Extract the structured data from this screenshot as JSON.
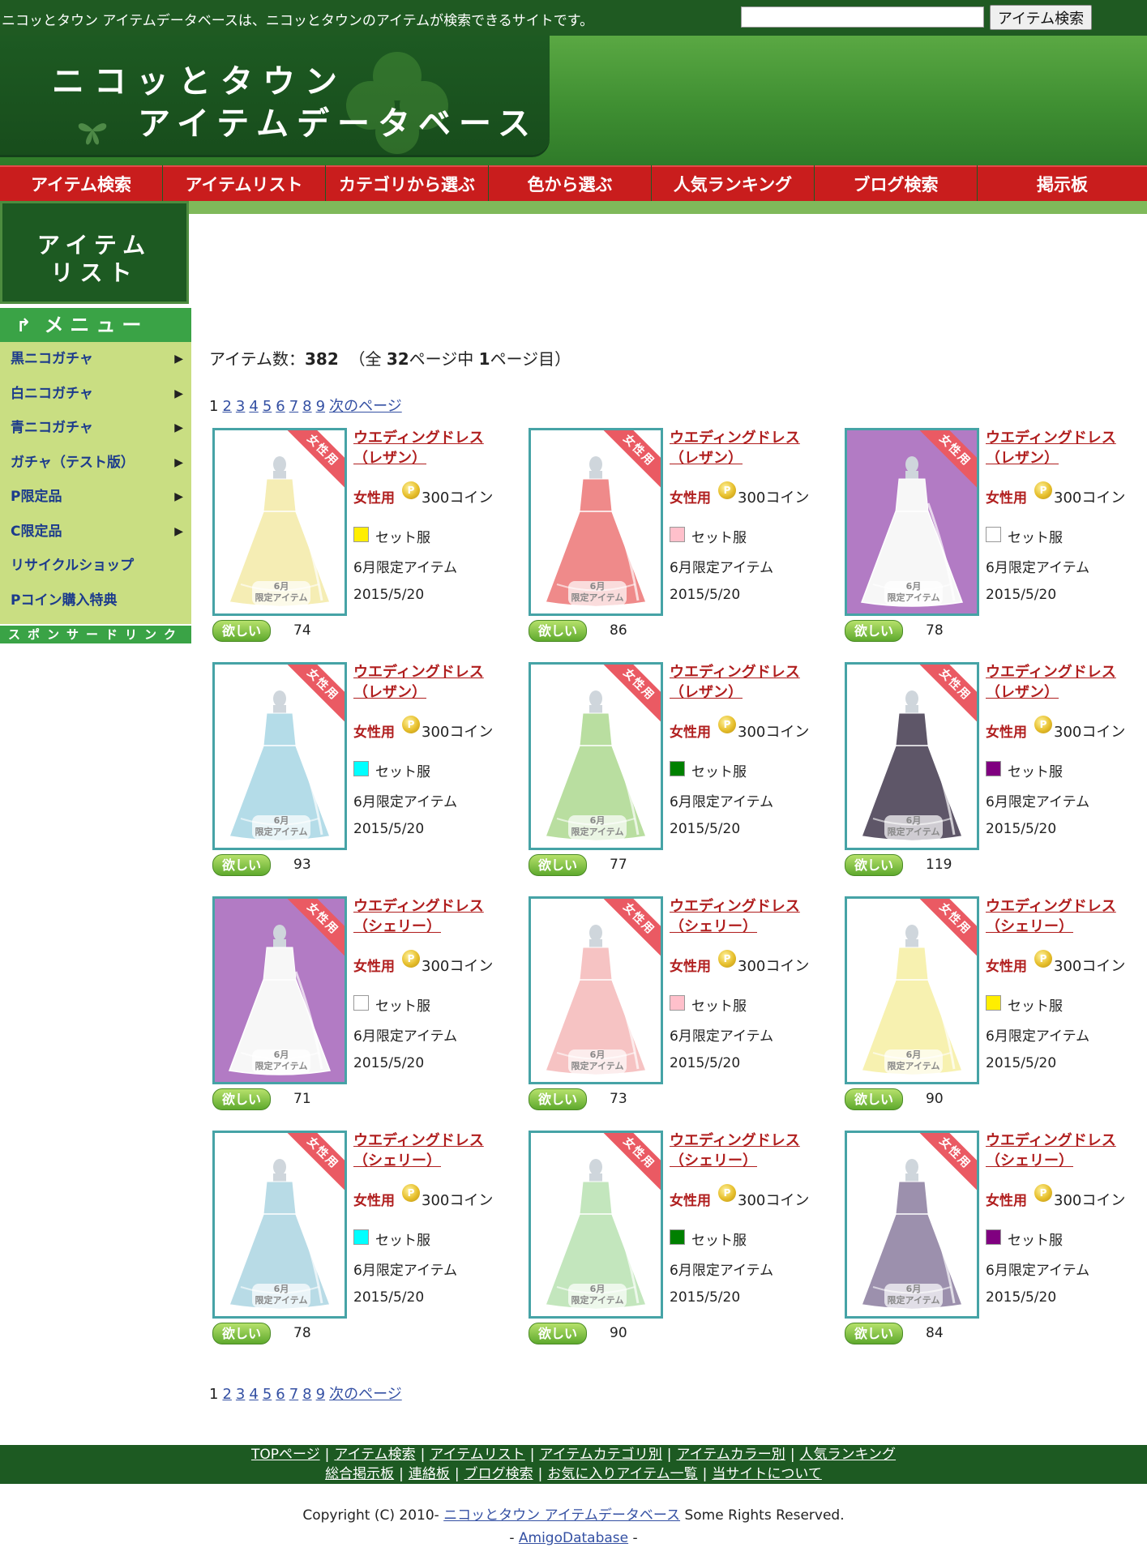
{
  "topbar": {
    "tagline": "ニコッとタウン アイテムデータベースは、ニコッとタウンのアイテムが検索できるサイトです。",
    "search_value": "",
    "search_button": "アイテム検索"
  },
  "logo": {
    "line1": "ニコッとタウン",
    "line2": "アイテムデータベース"
  },
  "nav": [
    "アイテム検索",
    "アイテムリスト",
    "カテゴリから選ぶ",
    "色から選ぶ",
    "人気ランキング",
    "ブログ検索",
    "掲示板"
  ],
  "sidebar": {
    "title_line1": "アイテム",
    "title_line2": "リスト",
    "menu_title": "メニュー",
    "items": [
      {
        "label": "黒ニコガチャ",
        "arrow": "▶"
      },
      {
        "label": "白ニコガチャ",
        "arrow": "▶"
      },
      {
        "label": "青ニコガチャ",
        "arrow": "▶"
      },
      {
        "label": "ガチャ（テスト版）",
        "arrow": "▶"
      },
      {
        "label": "P限定品",
        "arrow": "▶"
      },
      {
        "label": "C限定品",
        "arrow": "▶"
      },
      {
        "label": "リサイクルショップ",
        "arrow": ""
      },
      {
        "label": "Pコイン購入特典",
        "arrow": ""
      }
    ],
    "sponsor": "スポンサードリンク"
  },
  "summary": {
    "prefix": "アイテム数：",
    "count": "382",
    "mid1": "（全 ",
    "pages": "32",
    "mid2": "ページ中 ",
    "current": "1",
    "suffix": "ページ目）"
  },
  "pager": {
    "current": "1",
    "pages": [
      "2",
      "3",
      "4",
      "5",
      "6",
      "7",
      "8",
      "9"
    ],
    "next": "次のページ"
  },
  "items": [
    {
      "name1": "ウエディングドレス",
      "name2": "（レザン）",
      "gender": "女性用",
      "price": "300コイン",
      "set": "セット服",
      "limited": "6月限定アイテム",
      "date": "2015/5/20",
      "want": "欲しい",
      "want_count": "74",
      "ribbon": "女性用",
      "badge_month": "6月",
      "badge_text": "限定アイテム",
      "coin": "P",
      "color": "#ffee00",
      "dress": "#f5edb4",
      "bg": "white"
    },
    {
      "name1": "ウエディングドレス",
      "name2": "（レザン）",
      "gender": "女性用",
      "price": "300コイン",
      "set": "セット服",
      "limited": "6月限定アイテム",
      "date": "2015/5/20",
      "want": "欲しい",
      "want_count": "86",
      "ribbon": "女性用",
      "badge_month": "6月",
      "badge_text": "限定アイテム",
      "coin": "P",
      "color": "#ffc0cb",
      "dress": "#ef8a8a",
      "bg": "white"
    },
    {
      "name1": "ウエディングドレス",
      "name2": "（レザン）",
      "gender": "女性用",
      "price": "300コイン",
      "set": "セット服",
      "limited": "6月限定アイテム",
      "date": "2015/5/20",
      "want": "欲しい",
      "want_count": "78",
      "ribbon": "女性用",
      "badge_month": "6月",
      "badge_text": "限定アイテム",
      "coin": "P",
      "color": "#ffffff",
      "dress": "#f7f7f7",
      "bg": "purple"
    },
    {
      "name1": "ウエディングドレス",
      "name2": "（レザン）",
      "gender": "女性用",
      "price": "300コイン",
      "set": "セット服",
      "limited": "6月限定アイテム",
      "date": "2015/5/20",
      "want": "欲しい",
      "want_count": "93",
      "ribbon": "女性用",
      "badge_month": "6月",
      "badge_text": "限定アイテム",
      "coin": "P",
      "color": "#00ffff",
      "dress": "#b4dce8",
      "bg": "white"
    },
    {
      "name1": "ウエディングドレス",
      "name2": "（レザン）",
      "gender": "女性用",
      "price": "300コイン",
      "set": "セット服",
      "limited": "6月限定アイテム",
      "date": "2015/5/20",
      "want": "欲しい",
      "want_count": "77",
      "ribbon": "女性用",
      "badge_month": "6月",
      "badge_text": "限定アイテム",
      "coin": "P",
      "color": "#008000",
      "dress": "#b9dea0",
      "bg": "white"
    },
    {
      "name1": "ウエディングドレス",
      "name2": "（レザン）",
      "gender": "女性用",
      "price": "300コイン",
      "set": "セット服",
      "limited": "6月限定アイテム",
      "date": "2015/5/20",
      "want": "欲しい",
      "want_count": "119",
      "ribbon": "女性用",
      "badge_month": "6月",
      "badge_text": "限定アイテム",
      "coin": "P",
      "color": "#800080",
      "dress": "#5e5668",
      "bg": "white"
    },
    {
      "name1": "ウエディングドレス",
      "name2": "（シェリー）",
      "gender": "女性用",
      "price": "300コイン",
      "set": "セット服",
      "limited": "6月限定アイテム",
      "date": "2015/5/20",
      "want": "欲しい",
      "want_count": "71",
      "ribbon": "女性用",
      "badge_month": "6月",
      "badge_text": "限定アイテム",
      "coin": "P",
      "color": "#ffffff",
      "dress": "#f7f7f7",
      "bg": "purple"
    },
    {
      "name1": "ウエディングドレス",
      "name2": "（シェリー）",
      "gender": "女性用",
      "price": "300コイン",
      "set": "セット服",
      "limited": "6月限定アイテム",
      "date": "2015/5/20",
      "want": "欲しい",
      "want_count": "73",
      "ribbon": "女性用",
      "badge_month": "6月",
      "badge_text": "限定アイテム",
      "coin": "P",
      "color": "#ffc0cb",
      "dress": "#f6c3c3",
      "bg": "white"
    },
    {
      "name1": "ウエディングドレス",
      "name2": "（シェリー）",
      "gender": "女性用",
      "price": "300コイン",
      "set": "セット服",
      "limited": "6月限定アイテム",
      "date": "2015/5/20",
      "want": "欲しい",
      "want_count": "90",
      "ribbon": "女性用",
      "badge_month": "6月",
      "badge_text": "限定アイテム",
      "coin": "P",
      "color": "#ffee00",
      "dress": "#f7f1b0",
      "bg": "white"
    },
    {
      "name1": "ウエディングドレス",
      "name2": "（シェリー）",
      "gender": "女性用",
      "price": "300コイン",
      "set": "セット服",
      "limited": "6月限定アイテム",
      "date": "2015/5/20",
      "want": "欲しい",
      "want_count": "78",
      "ribbon": "女性用",
      "badge_month": "6月",
      "badge_text": "限定アイテム",
      "coin": "P",
      "color": "#00ffff",
      "dress": "#b8dbe6",
      "bg": "white"
    },
    {
      "name1": "ウエディングドレス",
      "name2": "（シェリー）",
      "gender": "女性用",
      "price": "300コイン",
      "set": "セット服",
      "limited": "6月限定アイテム",
      "date": "2015/5/20",
      "want": "欲しい",
      "want_count": "90",
      "ribbon": "女性用",
      "badge_month": "6月",
      "badge_text": "限定アイテム",
      "coin": "P",
      "color": "#008000",
      "dress": "#c3e6bd",
      "bg": "white"
    },
    {
      "name1": "ウエディングドレス",
      "name2": "（シェリー）",
      "gender": "女性用",
      "price": "300コイン",
      "set": "セット服",
      "limited": "6月限定アイテム",
      "date": "2015/5/20",
      "want": "欲しい",
      "want_count": "84",
      "ribbon": "女性用",
      "badge_month": "6月",
      "badge_text": "限定アイテム",
      "coin": "P",
      "color": "#800080",
      "dress": "#9c90ad",
      "bg": "white"
    }
  ],
  "footer": {
    "row1": [
      "TOPページ",
      "アイテム検索",
      "アイテムリスト",
      "アイテムカテゴリ別",
      "アイテムカラー別",
      "人気ランキング"
    ],
    "row2": [
      "総合掲示板",
      "連絡板",
      "ブログ検索",
      "お気に入りアイテム一覧",
      "当サイトについて"
    ],
    "separator": "|"
  },
  "copyright": {
    "prefix": "Copyright (C) 2010- ",
    "site_link": "ニコッとタウン アイテムデータベース",
    "suffix": " Some Rights Reserved.",
    "dash1": "- ",
    "amigo_link": "AmigoDatabase",
    "dash2": " -"
  }
}
